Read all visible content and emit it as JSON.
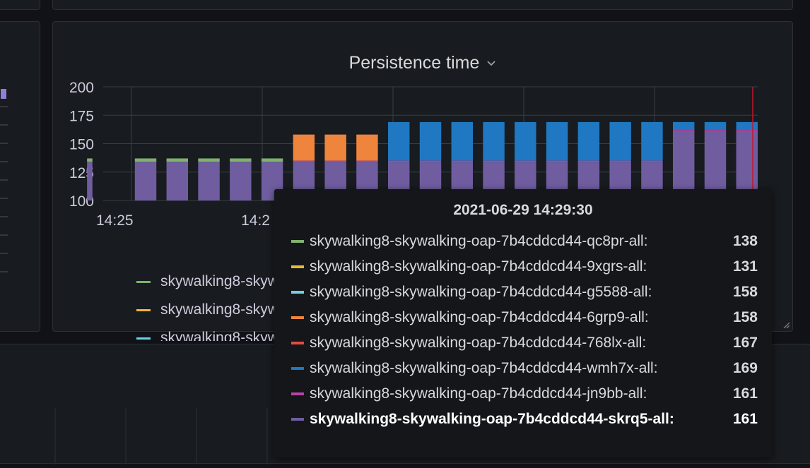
{
  "panel": {
    "title": "Persistence time",
    "chevron_icon": "chevron-down-icon"
  },
  "colors": {
    "green": "#7eb26d",
    "yellow": "#eab839",
    "cyan": "#6ed0e0",
    "orange": "#ef843c",
    "red": "#e24d42",
    "blue": "#1f78c1",
    "magenta": "#ba43a9",
    "purple": "#705da0",
    "cursor": "#c4162a"
  },
  "legend": {
    "items": [
      {
        "label": "skywalking8-skywalkir",
        "color": "#7eb26d"
      },
      {
        "label": "skywalking8-skywalkir",
        "color": "#eab839"
      },
      {
        "label": "skywalking8-skywalkir",
        "color": "#6ed0e0"
      }
    ]
  },
  "tooltip": {
    "time": "2021-06-29 14:29:30",
    "rows": [
      {
        "name": "skywalking8-skywalking-oap-7b4cddcd44-qc8pr-all:",
        "value": "138",
        "color": "#7eb26d"
      },
      {
        "name": "skywalking8-skywalking-oap-7b4cddcd44-9xgrs-all:",
        "value": "131",
        "color": "#eab839"
      },
      {
        "name": "skywalking8-skywalking-oap-7b4cddcd44-g5588-all:",
        "value": "158",
        "color": "#6ed0e0"
      },
      {
        "name": "skywalking8-skywalking-oap-7b4cddcd44-6grp9-all:",
        "value": "158",
        "color": "#ef843c"
      },
      {
        "name": "skywalking8-skywalking-oap-7b4cddcd44-768lx-all:",
        "value": "167",
        "color": "#e24d42"
      },
      {
        "name": "skywalking8-skywalking-oap-7b4cddcd44-wmh7x-all:",
        "value": "169",
        "color": "#1f78c1"
      },
      {
        "name": "skywalking8-skywalking-oap-7b4cddcd44-jn9bb-all:",
        "value": "161",
        "color": "#ba43a9"
      },
      {
        "name": "skywalking8-skywalking-oap-7b4cddcd44-skrq5-all:",
        "value": "161",
        "color": "#705da0",
        "highlight": true
      }
    ]
  },
  "chart_data": {
    "type": "bar",
    "ylim": [
      100,
      200
    ],
    "yticks": [
      100,
      125,
      150,
      175,
      200
    ],
    "xtick_labels": [
      {
        "label": "14:25",
        "bar_index": 1
      },
      {
        "label": "14:2",
        "bar_index": 5
      }
    ],
    "bars": [
      {
        "base": 134,
        "band": 3,
        "band_color": "#7eb26d",
        "top": null
      },
      {
        "base": 134,
        "band": 3,
        "band_color": "#7eb26d",
        "top": null
      },
      {
        "base": 134,
        "band": 3,
        "band_color": "#7eb26d",
        "top": null
      },
      {
        "base": 134,
        "band": 3,
        "band_color": "#7eb26d",
        "top": null
      },
      {
        "base": 134,
        "band": 3,
        "band_color": "#7eb26d",
        "top": null
      },
      {
        "base": 134,
        "band": 3,
        "band_color": "#7eb26d",
        "top": null
      },
      {
        "base": 134,
        "band": 1,
        "band_color": "#ba43a9",
        "top": {
          "value": 158,
          "color": "#ef843c"
        }
      },
      {
        "base": 134,
        "band": 1,
        "band_color": "#ba43a9",
        "top": {
          "value": 158,
          "color": "#ef843c"
        }
      },
      {
        "base": 134,
        "band": 1,
        "band_color": "#ba43a9",
        "top": {
          "value": 158,
          "color": "#ef843c"
        }
      },
      {
        "base": 134,
        "band": 1,
        "band_color": "#ba43a9",
        "top": {
          "value": 169,
          "color": "#1f78c1"
        }
      },
      {
        "base": 134,
        "band": 1,
        "band_color": "#ba43a9",
        "top": {
          "value": 169,
          "color": "#1f78c1"
        }
      },
      {
        "base": 134,
        "band": 1,
        "band_color": "#ba43a9",
        "top": {
          "value": 169,
          "color": "#1f78c1"
        }
      },
      {
        "base": 134,
        "band": 1,
        "band_color": "#ba43a9",
        "top": {
          "value": 169,
          "color": "#1f78c1"
        }
      },
      {
        "base": 134,
        "band": 1,
        "band_color": "#ba43a9",
        "top": {
          "value": 169,
          "color": "#1f78c1"
        }
      },
      {
        "base": 134,
        "band": 1,
        "band_color": "#ba43a9",
        "top": {
          "value": 169,
          "color": "#1f78c1"
        }
      },
      {
        "base": 134,
        "band": 1,
        "band_color": "#ba43a9",
        "top": {
          "value": 169,
          "color": "#1f78c1"
        }
      },
      {
        "base": 134,
        "band": 1,
        "band_color": "#ba43a9",
        "top": {
          "value": 169,
          "color": "#1f78c1"
        }
      },
      {
        "base": 134,
        "band": 1,
        "band_color": "#ba43a9",
        "top": {
          "value": 169,
          "color": "#1f78c1"
        }
      },
      {
        "base": 161,
        "band": 1,
        "band_color": "#ba43a9",
        "top": {
          "value": 169,
          "color": "#1f78c1"
        }
      },
      {
        "base": 161,
        "band": 1,
        "band_color": "#ba43a9",
        "top": {
          "value": 169,
          "color": "#1f78c1"
        }
      },
      {
        "base": 161,
        "band": 1,
        "band_color": "#ba43a9",
        "top": {
          "value": 169,
          "color": "#1f78c1"
        }
      }
    ]
  }
}
